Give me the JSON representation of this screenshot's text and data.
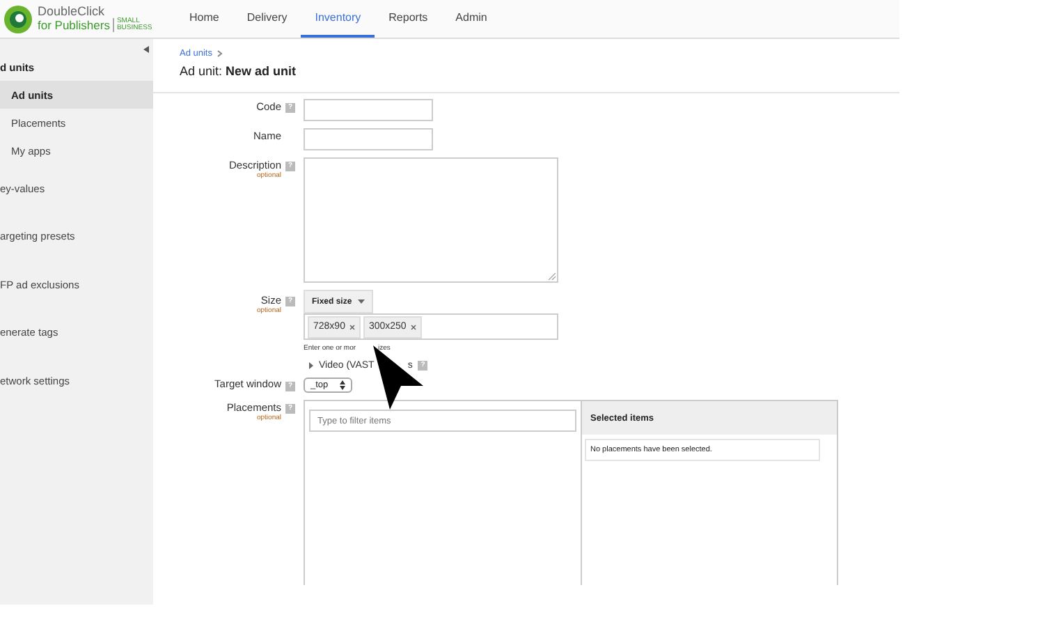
{
  "logo": {
    "line1": "DoubleClick",
    "line2": "for Publishers",
    "badge": "SMALL BUSINESS"
  },
  "nav": [
    {
      "label": "Home",
      "selected": false
    },
    {
      "label": "Delivery",
      "selected": false
    },
    {
      "label": "Inventory",
      "selected": true
    },
    {
      "label": "Reports",
      "selected": false
    },
    {
      "label": "Admin",
      "selected": false
    }
  ],
  "sidebar": {
    "items": [
      {
        "label": "d units",
        "kind": "section",
        "selected": false
      },
      {
        "label": "Ad units",
        "kind": "item",
        "selected": true
      },
      {
        "label": "Placements",
        "kind": "item",
        "selected": false
      },
      {
        "label": "My apps",
        "kind": "item",
        "selected": false
      },
      {
        "label": "ey-values",
        "kind": "section",
        "selected": false
      },
      {
        "label": "argeting presets",
        "kind": "section",
        "selected": false
      },
      {
        "label": "FP ad exclusions",
        "kind": "section",
        "selected": false
      },
      {
        "label": "enerate tags",
        "kind": "section",
        "selected": false
      },
      {
        "label": "etwork settings",
        "kind": "section",
        "selected": false
      }
    ]
  },
  "breadcrumb": "Ad units",
  "title": "Ad unit: **New ad unit**",
  "form": {
    "code": {
      "label": "Code",
      "help": "?"
    },
    "name": {
      "label": "Name"
    },
    "description": {
      "label": "Description",
      "help": "?",
      "optional": "optional"
    },
    "size": {
      "label": "Size",
      "help": "?",
      "optional": "optional",
      "mode": "Fixed size",
      "tags": [
        "728x90",
        "300x250"
      ],
      "hint": [
        "Enter one or mor",
        "izes"
      ],
      "video": [
        "Video (VAST",
        "s"
      ],
      "video_help": "?"
    },
    "target_window": {
      "label": "Target window",
      "help": "?",
      "value": "_top"
    },
    "placements": {
      "label": "Placements",
      "help": "?",
      "optional": "optional",
      "filter_placeholder": "Type to filter items",
      "selected_title": "Selected items",
      "empty": "No placements have been selected."
    }
  }
}
